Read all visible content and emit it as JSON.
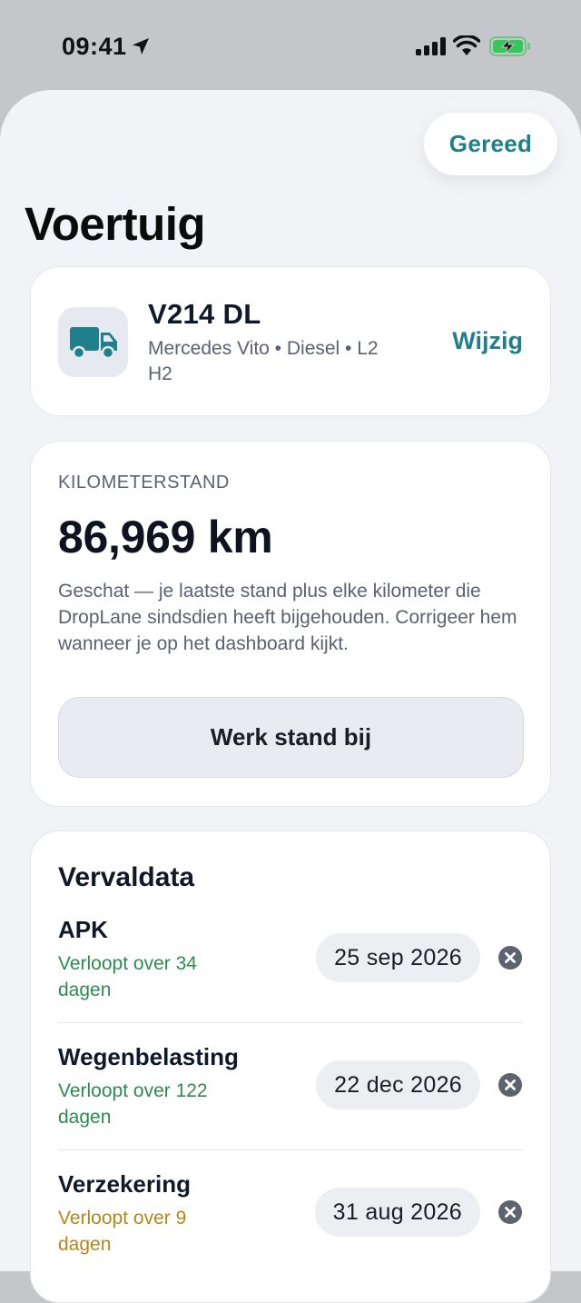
{
  "status_bar": {
    "time": "09:41"
  },
  "header": {
    "done_label": "Gereed",
    "title": "Voertuig"
  },
  "vehicle": {
    "plate": "V214 DL",
    "description": "Mercedes Vito • Diesel • L2 H2",
    "edit_label": "Wijzig",
    "icon": "truck-icon"
  },
  "odometer": {
    "label": "KILOMETERSTAND",
    "value": "86,969 km",
    "note": "Geschat — je laatste stand plus elke kilometer die DropLane sindsdien heeft bijgehouden. Corrigeer hem wanneer je op het dashboard kijkt.",
    "update_label": "Werk stand bij"
  },
  "due_dates": {
    "title": "Vervaldata",
    "items": [
      {
        "name": "APK",
        "status": "Verloopt over 34 dagen",
        "date": "25 sep 2026",
        "status_color": "#2e8a52"
      },
      {
        "name": "Wegenbelasting",
        "status": "Verloopt over 122 dagen",
        "date": "22 dec 2026",
        "status_color": "#2e8a52"
      },
      {
        "name": "Verzekering",
        "status": "Verloopt over 9 dagen",
        "date": "31 aug 2026",
        "status_color": "#b6861b"
      }
    ]
  },
  "colors": {
    "accent": "#1f7f8a",
    "ok": "#2e8a52",
    "warn": "#b6861b",
    "battery": "#34c759"
  }
}
